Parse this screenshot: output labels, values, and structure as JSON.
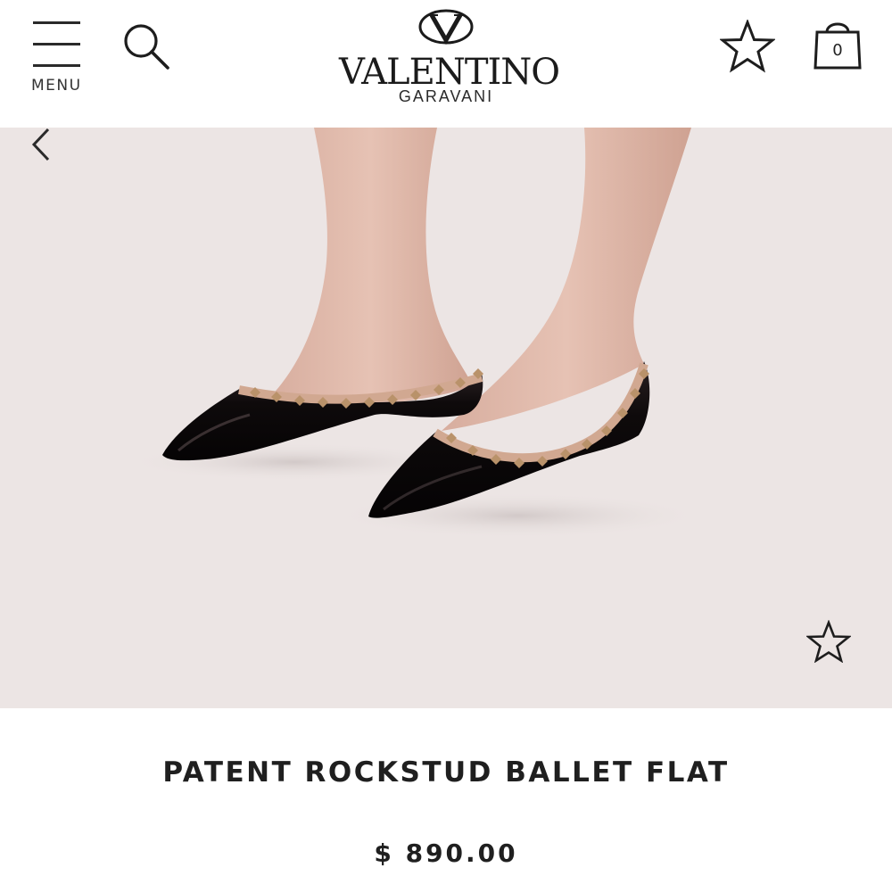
{
  "header": {
    "menu_label": "MENU",
    "brand_name": "VALENTINO",
    "brand_sub": "GARAVANI",
    "bag_count": "0",
    "icons": [
      "hamburger-menu-icon",
      "search-icon",
      "star-icon",
      "shopping-bag-icon"
    ]
  },
  "hero": {
    "icons": [
      "chevron-left-icon",
      "star-outline-icon"
    ],
    "background_color": "#ece5e4"
  },
  "product": {
    "name": "PATENT ROCKSTUD BALLET FLAT",
    "price": "$ 890.00"
  }
}
